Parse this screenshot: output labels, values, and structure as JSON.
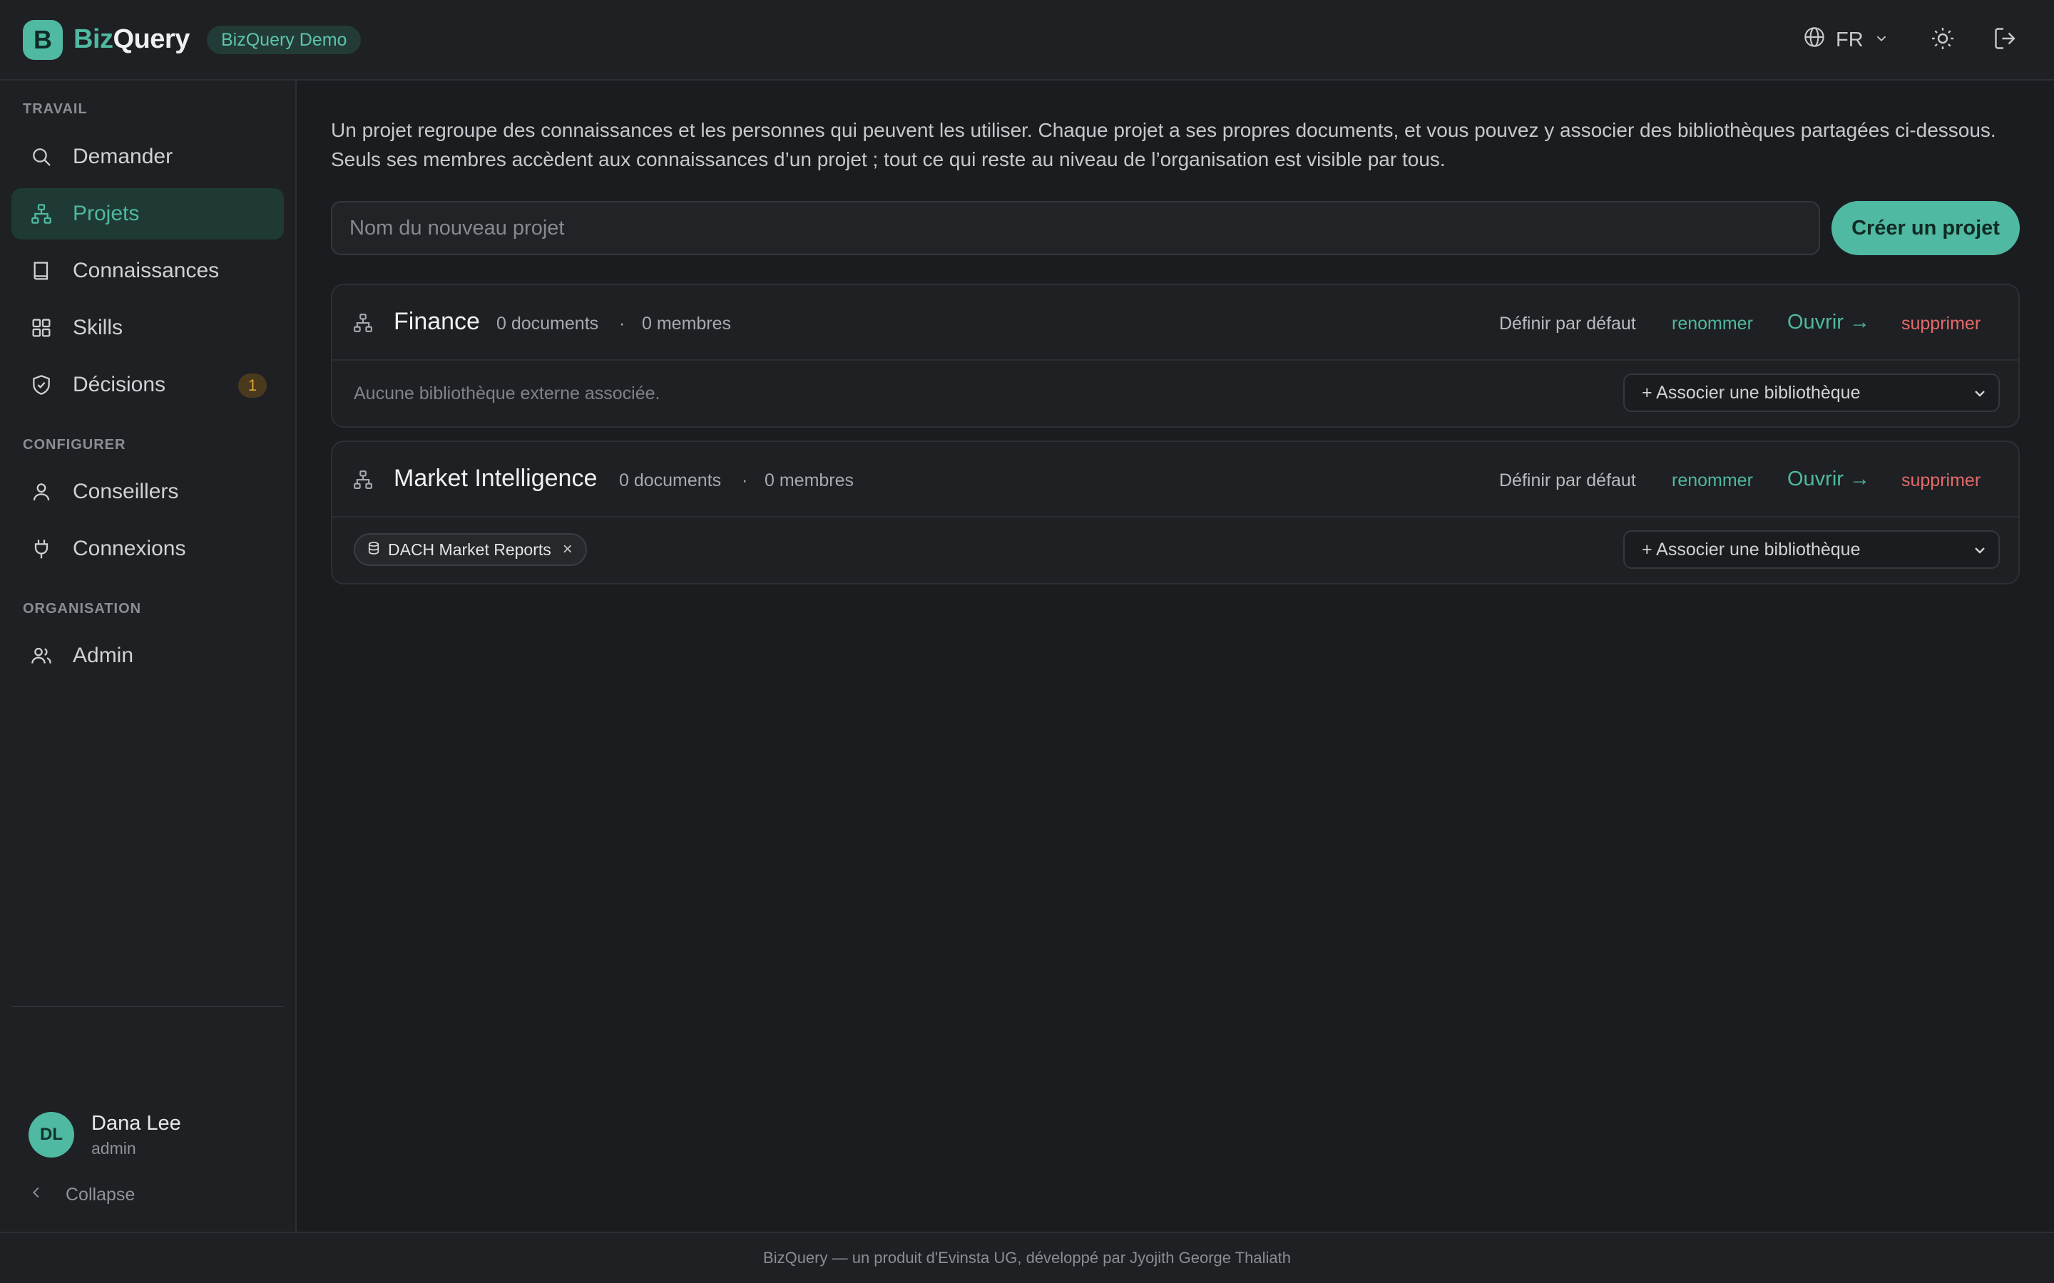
{
  "header": {
    "logo_letter": "B",
    "brand_part1": "Biz",
    "brand_part2": "Query",
    "workspace_badge": "BizQuery Demo",
    "language": "FR",
    "icons": [
      "globe-icon",
      "chevron-down-icon",
      "sun-icon",
      "logout-icon"
    ]
  },
  "sidebar": {
    "sections": {
      "work": "TRAVAIL",
      "configure": "CONFIGURER",
      "organisation": "ORGANISATION"
    },
    "items": [
      {
        "label": "Demander",
        "icon": "search-icon"
      },
      {
        "label": "Projets",
        "icon": "hierarchy-icon",
        "active": true
      },
      {
        "label": "Connaissances",
        "icon": "book-icon"
      },
      {
        "label": "Skills",
        "icon": "grid-icon"
      },
      {
        "label": "Décisions",
        "icon": "shield-check-icon",
        "badge": "1"
      },
      {
        "label": "Conseillers",
        "icon": "user-icon"
      },
      {
        "label": "Connexions",
        "icon": "plug-icon"
      },
      {
        "label": "Admin",
        "icon": "users-icon"
      }
    ],
    "user": {
      "initials": "DL",
      "name": "Dana Lee",
      "role": "admin"
    },
    "collapse_label": "Collapse"
  },
  "main": {
    "intro": "Un projet regroupe des connaissances et les personnes qui peuvent les utiliser. Chaque projet a ses propres documents, et vous pouvez y associer des bibliothèques partagées ci-dessous. Seuls ses membres accèdent aux connaissances d’un projet ; tout ce qui reste au niveau de l’organisation est visible par tous.",
    "new_project_placeholder": "Nom du nouveau projet",
    "create_label": "Créer un projet",
    "projects": [
      {
        "name": "Finance",
        "documents": "0 documents",
        "separator": "·",
        "members": "0 membres",
        "set_default": "Définir par défaut",
        "rename": "renommer",
        "open": "Ouvrir →",
        "delete": "supprimer",
        "no_library": "Aucune bibliothèque externe associée.",
        "libraries": [],
        "associate": "+ Associer une bibliothèque"
      },
      {
        "name": "Market Intelligence",
        "documents": "0 documents",
        "separator": "·",
        "members": "0 membres",
        "set_default": "Définir par défaut",
        "rename": "renommer",
        "open": "Ouvrir →",
        "delete": "supprimer",
        "libraries": [
          "DACH Market Reports"
        ],
        "remove_symbol": "×",
        "associate": "+ Associer une bibliothèque"
      }
    ]
  },
  "footer": {
    "text": "BizQuery — un produit d'Evinsta UG, développé par Jyojith George Thaliath"
  },
  "colors": {
    "accent": "#4fb9a1",
    "danger": "#e36a6a",
    "background": "#1a1c1f",
    "badge": "#e0a53c"
  }
}
